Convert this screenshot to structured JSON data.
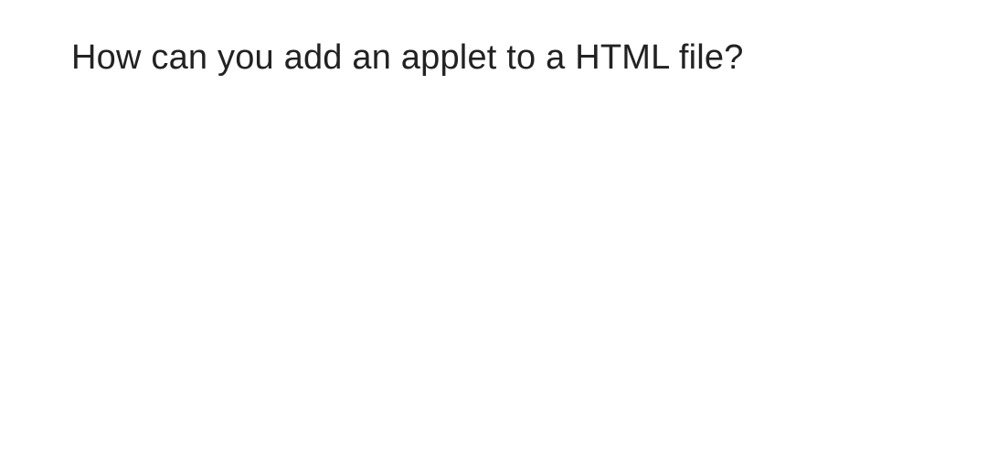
{
  "question": {
    "text": "How can you add an applet to a HTML file?"
  }
}
